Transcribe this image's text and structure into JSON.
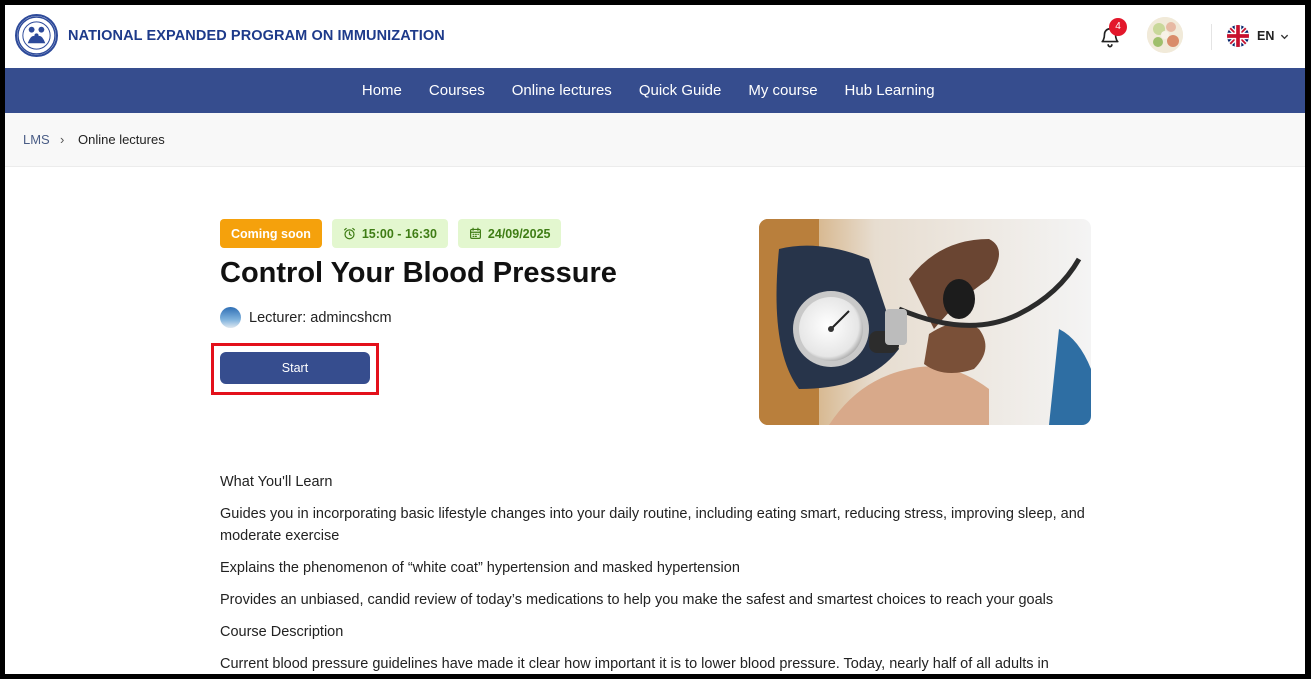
{
  "header": {
    "org_name": "NATIONAL EXPANDED PROGRAM ON IMMUNIZATION",
    "notification_count": "4",
    "language_code": "EN"
  },
  "nav": {
    "items": [
      {
        "label": "Home"
      },
      {
        "label": "Courses"
      },
      {
        "label": "Online lectures"
      },
      {
        "label": "Quick Guide"
      },
      {
        "label": "My course"
      },
      {
        "label": "Hub Learning"
      }
    ]
  },
  "breadcrumb": {
    "home": "LMS",
    "separator": "›",
    "current": "Online lectures"
  },
  "lecture": {
    "status": "Coming soon",
    "time": "15:00 - 16:30",
    "date": "24/09/2025",
    "title": "Control Your Blood Pressure",
    "lecturer": "Lecturer: admincshcm",
    "start_label": "Start"
  },
  "content": {
    "paragraphs": [
      "What You'll Learn",
      "Guides you in incorporating basic lifestyle changes into your daily routine, including eating smart, reducing stress, improving sleep, and moderate exercise",
      "Explains the phenomenon of “white coat” hypertension and masked hypertension",
      "Provides an unbiased, candid review of today’s medications to help you make the safest and smartest choices to reach your goals",
      "Course Description",
      "Current blood pressure guidelines have made it clear how important it is to lower blood pressure. Today, nearly half of all adults in"
    ]
  },
  "icons": {
    "logo": "immunization-logo-icon",
    "bell": "bell-icon",
    "flag": "uk-flag-icon",
    "chevron": "chevron-down-icon",
    "alarm": "alarm-clock-icon",
    "calendar": "calendar-icon"
  },
  "colors": {
    "brand_blue": "#364d8e",
    "status_orange": "#f5a10c",
    "badge_green_bg": "#e3f7cf",
    "badge_green_text": "#3f7d15",
    "highlight_red": "#e3101b",
    "notification_red": "#e3172b"
  }
}
